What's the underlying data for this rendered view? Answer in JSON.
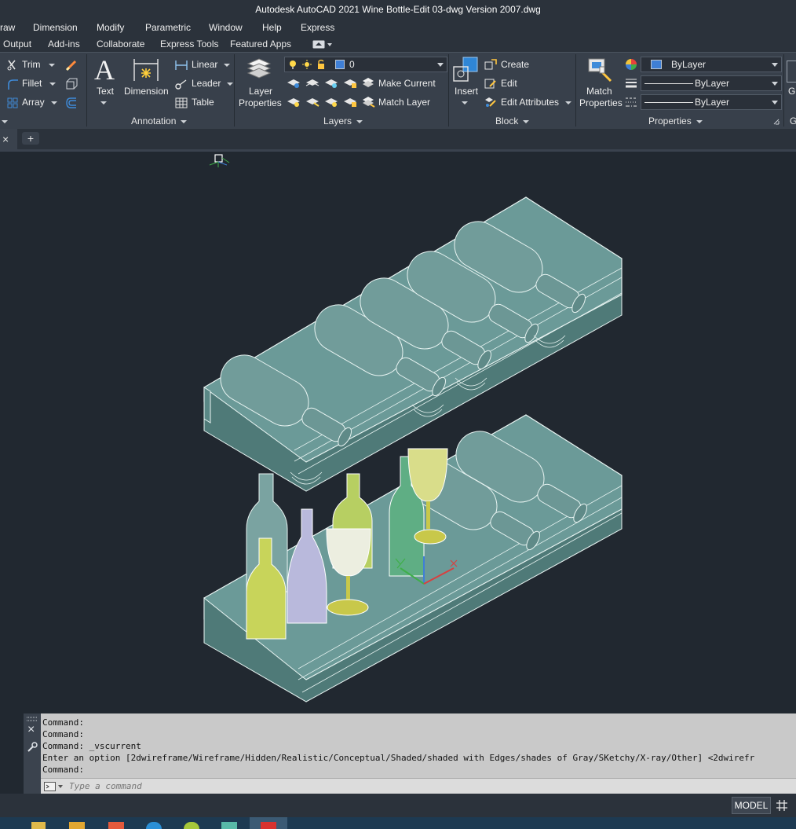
{
  "title": "Autodesk AutoCAD 2021    Wine Bottle-Edit 03-dwg Version 2007.dwg",
  "menu": [
    "raw",
    "Dimension",
    "Modify",
    "Parametric",
    "Window",
    "Help",
    "Express"
  ],
  "tabs": [
    "Output",
    "Add-ins",
    "Collaborate",
    "Express Tools",
    "Featured Apps"
  ],
  "ribbon": {
    "modify": {
      "trim": "Trim",
      "fillet": "Fillet",
      "array": "Array"
    },
    "annotation": {
      "text": "Text",
      "dimension": "Dimension",
      "linear": "Linear",
      "leader": "Leader",
      "table": "Table",
      "footer": "Annotation"
    },
    "layers": {
      "layer_properties": [
        "Layer",
        "Properties"
      ],
      "current_layer": "0",
      "make_current": "Make Current",
      "match_layer": "Match Layer",
      "footer": "Layers"
    },
    "block": {
      "insert": "Insert",
      "create": "Create",
      "edit": "Edit",
      "edit_attributes": "Edit Attributes",
      "footer": "Block"
    },
    "properties": {
      "match_properties": [
        "Match",
        "Properties"
      ],
      "color": "ByLayer",
      "linetype": "ByLayer",
      "lineweight": "ByLayer",
      "footer": "Properties"
    },
    "overflow": "G"
  },
  "file_tabs": {
    "close": "×",
    "new": "+"
  },
  "command": {
    "history": [
      "Command:",
      "Command:",
      "Command: _vscurrent",
      "Enter an option [2dwireframe/Wireframe/Hidden/Realistic/Conceptual/Shaded/shaded with Edges/shades of Gray/SKetchy/X-ray/Other] <2dwirefr",
      "Command:"
    ],
    "placeholder": "Type a command"
  },
  "status": {
    "model": "MODEL"
  },
  "colors": {
    "accent_layer": "#3f7fd6",
    "rack": "#6b9a98",
    "bottle": "#6f9896",
    "glass_yellow": "#c8c84a"
  }
}
